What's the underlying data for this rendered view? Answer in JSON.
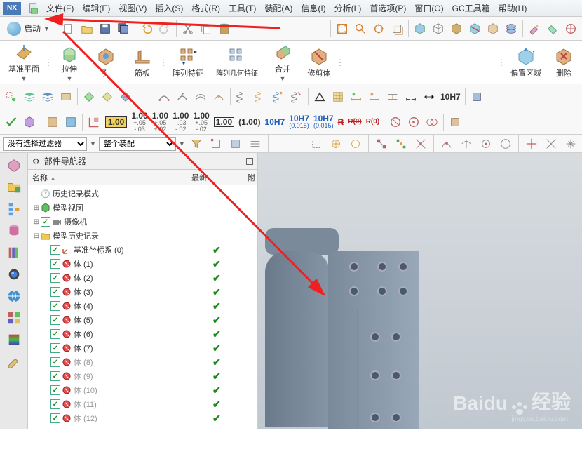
{
  "app": {
    "logo": "NX"
  },
  "menu": {
    "file": "文件(F)",
    "edit": "编辑(E)",
    "view": "视图(V)",
    "insert": "插入(S)",
    "format": "格式(R)",
    "tools": "工具(T)",
    "assembly": "装配(A)",
    "info": "信息(I)",
    "analysis": "分析(L)",
    "preferences": "首选项(P)",
    "window": "窗口(O)",
    "gc": "GC工具箱",
    "help": "帮助(H)"
  },
  "toolbar": {
    "start": "启动"
  },
  "ribbon": {
    "datum": "基准平面",
    "extrude": "拉伸",
    "hole": "孔",
    "rib": "筋板",
    "pattern": "阵列特征",
    "geom_pattern": "阵列几何特征",
    "merge": "合并",
    "trim": "修剪体",
    "offset_region": "偏置区域",
    "delete": "删除"
  },
  "tolerances": {
    "t1": {
      "v": "1.00",
      "p": "+.05",
      "m": "-.03"
    },
    "t2": {
      "v": "1.00",
      "p": "+.05",
      "m": "+.02"
    },
    "t3": {
      "v": "1.00",
      "p": "-.03",
      "m": "-.02"
    },
    "t4": {
      "v": "1.00",
      "p": "+.05",
      "m": "-.02"
    },
    "box1": "1.00",
    "plain": "(1.00)",
    "h1": "10H7",
    "h2": {
      "v": "10H7",
      "s": "(0.015)"
    },
    "h3": {
      "v": "10H7",
      "s": "(0.015)"
    },
    "r1": "R",
    "r2": "R(0)",
    "r3": "R(0)",
    "last": "10H7"
  },
  "filters": {
    "no_filter": "没有选择过滤器",
    "whole_assembly": "整个装配"
  },
  "navigator": {
    "title": "部件导航器",
    "col_name": "名称",
    "col_recent": "最新",
    "col_r": "附",
    "history_mode": "历史记录模式",
    "model_view": "模型视图",
    "camera": "摄像机",
    "model_history": "模型历史记录",
    "datum_csys": "基准坐标系 (0)",
    "bodies": [
      {
        "name": "体 (1)",
        "gray": false
      },
      {
        "name": "体 (2)",
        "gray": false
      },
      {
        "name": "体 (3)",
        "gray": false
      },
      {
        "name": "体 (4)",
        "gray": false
      },
      {
        "name": "体 (5)",
        "gray": false
      },
      {
        "name": "体 (6)",
        "gray": false
      },
      {
        "name": "体 (7)",
        "gray": false
      },
      {
        "name": "体 (8)",
        "gray": true
      },
      {
        "name": "体 (9)",
        "gray": true
      },
      {
        "name": "体 (10)",
        "gray": true
      },
      {
        "name": "体 (11)",
        "gray": true
      },
      {
        "name": "体 (12)",
        "gray": true
      }
    ]
  },
  "watermark": {
    "text": "Baidu",
    "suffix": "经验",
    "url": "jingyan.baidu.com"
  }
}
